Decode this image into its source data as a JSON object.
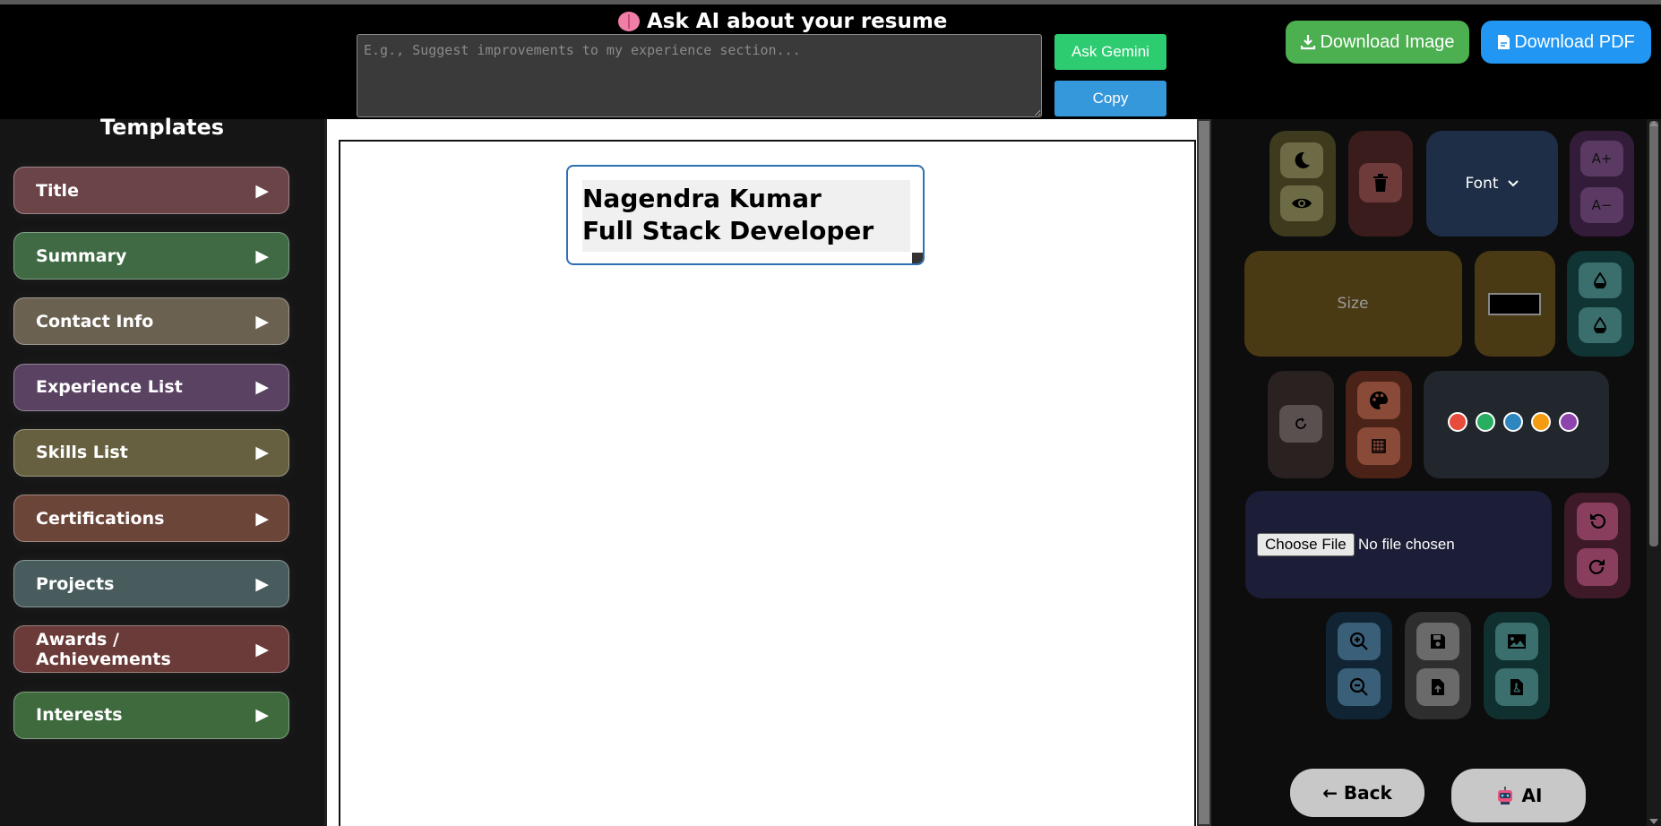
{
  "header": {
    "ai_title": "Ask AI about your resume",
    "ai_placeholder": "E.g., Suggest improvements to my experience section...",
    "ask_label": "Ask Gemini",
    "copy_label": "Copy",
    "download_image_label": "Download Image",
    "download_pdf_label": "Download PDF"
  },
  "sidebar": {
    "title": "Templates",
    "items": [
      {
        "label": "Title",
        "color": "#6b4448"
      },
      {
        "label": "Summary",
        "color": "#3f6a44"
      },
      {
        "label": "Contact Info",
        "color": "#6b6151"
      },
      {
        "label": "Experience List",
        "color": "#5a4262"
      },
      {
        "label": "Skills List",
        "color": "#666040"
      },
      {
        "label": "Certifications",
        "color": "#6c4539"
      },
      {
        "label": "Projects",
        "color": "#495c5d"
      },
      {
        "label": "Awards / Achievements",
        "color": "#6a3b38"
      },
      {
        "label": "Interests",
        "color": "#3f6a3e"
      }
    ]
  },
  "canvas": {
    "lines": [
      "Nagendra Kumar",
      "Full Stack Developer"
    ]
  },
  "toolbar": {
    "font_label": "Font",
    "size_label": "Size",
    "font_increase": "A+",
    "font_decrease": "A−",
    "swatches": [
      "#e74c3c",
      "#27ae60",
      "#2e86c1",
      "#f39c12",
      "#8e44ad"
    ],
    "file_button": "Choose File",
    "file_status": "No file chosen",
    "back_label": "← Back",
    "ai_label": "AI"
  }
}
